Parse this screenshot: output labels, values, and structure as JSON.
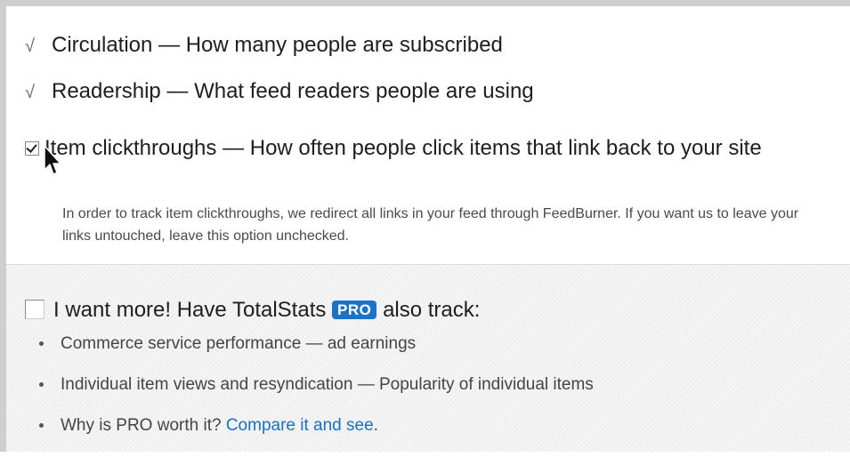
{
  "stats": {
    "circulation": {
      "check": "√",
      "text": "Circulation — How many people are subscribed"
    },
    "readership": {
      "check": "√",
      "text": "Readership — What feed readers people are using"
    },
    "clickthroughs": {
      "checked": true,
      "text": "Item clickthroughs — How often people click items that link back to your site",
      "note": "In order to track item clickthroughs, we redirect all links in your feed through FeedBurner. If you want us to leave your links untouched, leave this option unchecked."
    }
  },
  "pro": {
    "checked": false,
    "label_before": "I want more! Have TotalStats",
    "badge": "PRO",
    "label_after": "also track:",
    "badge_color": "#1a73c9",
    "items": [
      {
        "text": "Commerce service performance — ad earnings"
      },
      {
        "text": "Individual item views and resyndication — Popularity of individual items"
      },
      {
        "text": "Why is PRO worth it?",
        "link": "Compare it and see",
        "suffix": "."
      }
    ]
  },
  "colors": {
    "link": "#1a6fc7",
    "frame_border": "#cfcfcf"
  }
}
